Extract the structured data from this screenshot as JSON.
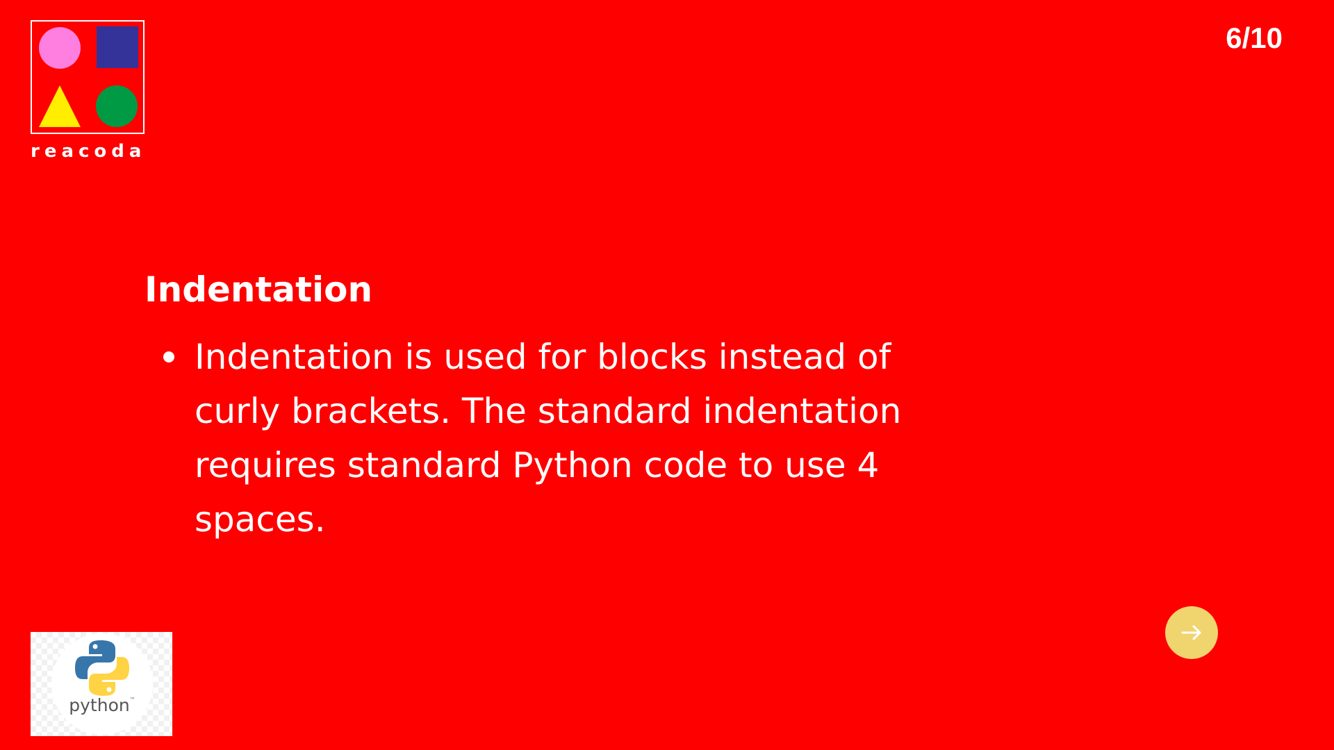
{
  "colors": {
    "background": "#ff0000",
    "text": "#ffffff",
    "logo_pink": "#ff7fe0",
    "logo_blue": "#33339a",
    "logo_yellow": "#ffee00",
    "logo_green": "#009944",
    "next_button": "#f0d46e"
  },
  "logo": {
    "text": "reacoda"
  },
  "page_counter": "6/10",
  "slide": {
    "title": "Indentation",
    "bullets": [
      {
        "text": "Indentation is used for blocks instead of curly brackets. The standard indentation requires standard Python code to use 4 spaces."
      }
    ]
  },
  "python_logo": {
    "wordmark": "python",
    "trademark": "™"
  },
  "navigation": {
    "next_icon": "arrow-right-icon"
  }
}
